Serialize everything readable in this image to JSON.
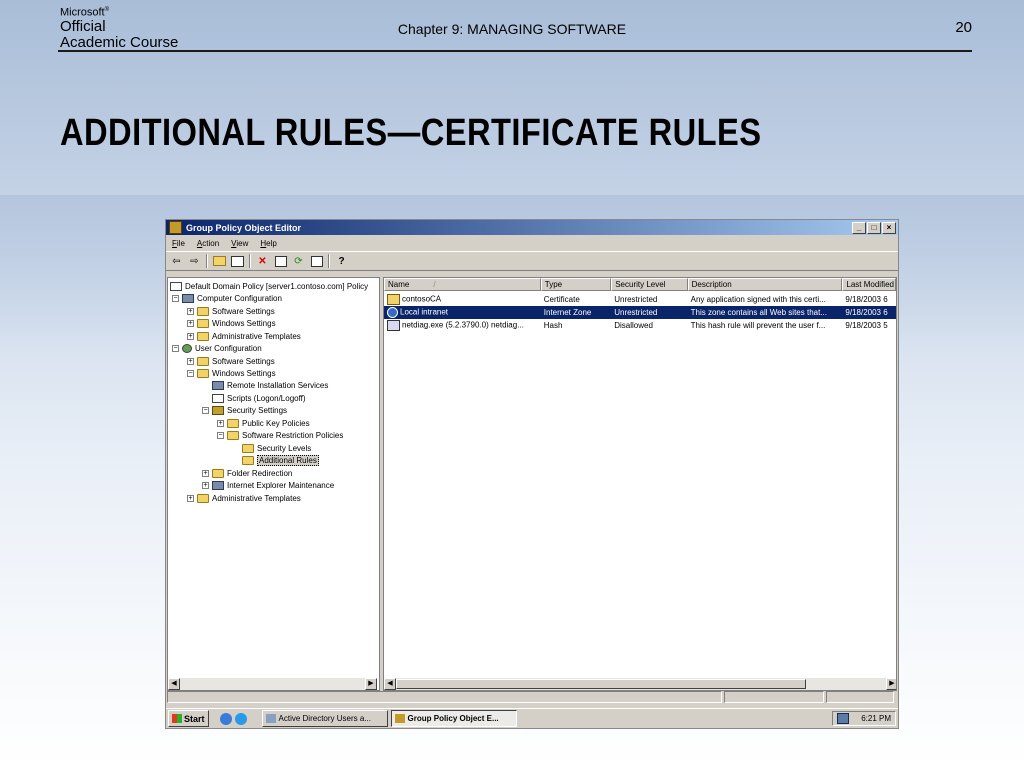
{
  "slide": {
    "logo": {
      "line1": "Microsoft",
      "line2": "Official",
      "line3": "Academic Course"
    },
    "chapter": "Chapter 9: MANAGING SOFTWARE",
    "page_number": "20",
    "title": "ADDITIONAL RULES—CERTIFICATE RULES"
  },
  "window": {
    "title": "Group Policy Object Editor",
    "buttons": {
      "minimize": "_",
      "restore": "□",
      "close": "×"
    },
    "menu": [
      {
        "label": "File",
        "accel": "F",
        "rest": "ile"
      },
      {
        "label": "Action",
        "accel": "A",
        "rest": "ction"
      },
      {
        "label": "View",
        "accel": "V",
        "rest": "iew"
      },
      {
        "label": "Help",
        "accel": "H",
        "rest": "elp"
      }
    ],
    "toolbar": [
      "back-icon",
      "forward-icon",
      "up-folder-icon",
      "show-hide-tree-icon",
      "delete-icon",
      "properties-icon",
      "refresh-icon",
      "export-list-icon",
      "help-icon"
    ]
  },
  "tree": {
    "items": [
      {
        "label": "Default Domain Policy [server1.contoso.com] Policy",
        "icon": "policy-icon",
        "level": 0
      },
      {
        "label": "Computer Configuration",
        "icon": "computer-icon",
        "level": 0,
        "expander": "−"
      },
      {
        "label": "Software Settings",
        "icon": "folder-icon",
        "level": 1,
        "expander": "+"
      },
      {
        "label": "Windows Settings",
        "icon": "folder-icon",
        "level": 1,
        "expander": "+"
      },
      {
        "label": "Administrative Templates",
        "icon": "folder-icon",
        "level": 1,
        "expander": "+"
      },
      {
        "label": "User Configuration",
        "icon": "user-icon",
        "level": 0,
        "expander": "−"
      },
      {
        "label": "Software Settings",
        "icon": "folder-icon",
        "level": 1,
        "expander": "+"
      },
      {
        "label": "Windows Settings",
        "icon": "folder-icon",
        "level": 1,
        "expander": "−"
      },
      {
        "label": "Remote Installation Services",
        "icon": "computer-icon",
        "level": 2
      },
      {
        "label": "Scripts (Logon/Logoff)",
        "icon": "document-icon",
        "level": 2
      },
      {
        "label": "Security Settings",
        "icon": "shield-icon",
        "level": 2,
        "expander": "−"
      },
      {
        "label": "Public Key Policies",
        "icon": "folder-icon",
        "level": 3,
        "expander": "+"
      },
      {
        "label": "Software Restriction Policies",
        "icon": "folder-icon",
        "level": 3,
        "expander": "−"
      },
      {
        "label": "Security Levels",
        "icon": "folder-icon",
        "level": 4
      },
      {
        "label": "Additional Rules",
        "icon": "folder-open-icon",
        "level": 4,
        "selected": true
      },
      {
        "label": "Folder Redirection",
        "icon": "folder-icon",
        "level": 2,
        "expander": "+"
      },
      {
        "label": "Internet Explorer Maintenance",
        "icon": "ie-maintenance-icon",
        "level": 2,
        "expander": "+"
      },
      {
        "label": "Administrative Templates",
        "icon": "folder-icon",
        "level": 1,
        "expander": "+"
      }
    ]
  },
  "list": {
    "columns": [
      "Name",
      "Type",
      "Security Level",
      "Description",
      "Last Modified"
    ],
    "sort_indicator": "/",
    "rows": [
      {
        "name": "contosoCA",
        "type": "Certificate",
        "level": "Unrestricted",
        "description": "Any application signed with this certi...",
        "modified": "9/18/2003  6",
        "icon": "certificate-icon",
        "selected": false
      },
      {
        "name": "Local intranet",
        "type": "Internet Zone",
        "level": "Unrestricted",
        "description": "This zone contains all Web sites that...",
        "modified": "9/18/2003  6",
        "icon": "globe-icon",
        "selected": true
      },
      {
        "name": "netdiag.exe (5.2.3790.0)  netdiag...",
        "type": "Hash",
        "level": "Disallowed",
        "description": "This hash rule will prevent the user f...",
        "modified": "9/18/2003  5",
        "icon": "hash-rule-icon",
        "selected": false
      }
    ]
  },
  "taskbar": {
    "start_label": "Start",
    "buttons": [
      {
        "label": "Active Directory Users a...",
        "active": false
      },
      {
        "label": "Group Policy Object E...",
        "active": true
      }
    ],
    "clock": "6:21 PM"
  },
  "colors": {
    "selection": "#0a246a",
    "titlebar_start": "#0a246a",
    "titlebar_end": "#a6caf0",
    "chrome": "#d4d0c8"
  }
}
